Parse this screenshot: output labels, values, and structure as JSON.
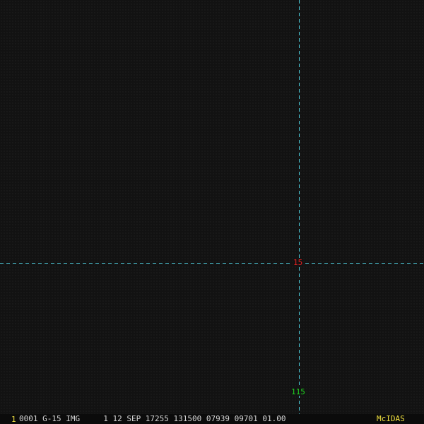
{
  "overlay": {
    "grid_color": "#4cc8d8",
    "latitude_label": "15",
    "latitude_label_color": "#e02020",
    "longitude_label": "115",
    "longitude_label_color": "#20d020"
  },
  "status_bar": {
    "frame_number": "1",
    "frame_number_color": "#f0e040",
    "header_text": "0001 G-15 IMG     1 12 SEP 17255 131500 07939 09701 01.00",
    "header_text_color": "#d8d8d8",
    "brand": "McIDAS",
    "brand_color": "#f0e040"
  }
}
